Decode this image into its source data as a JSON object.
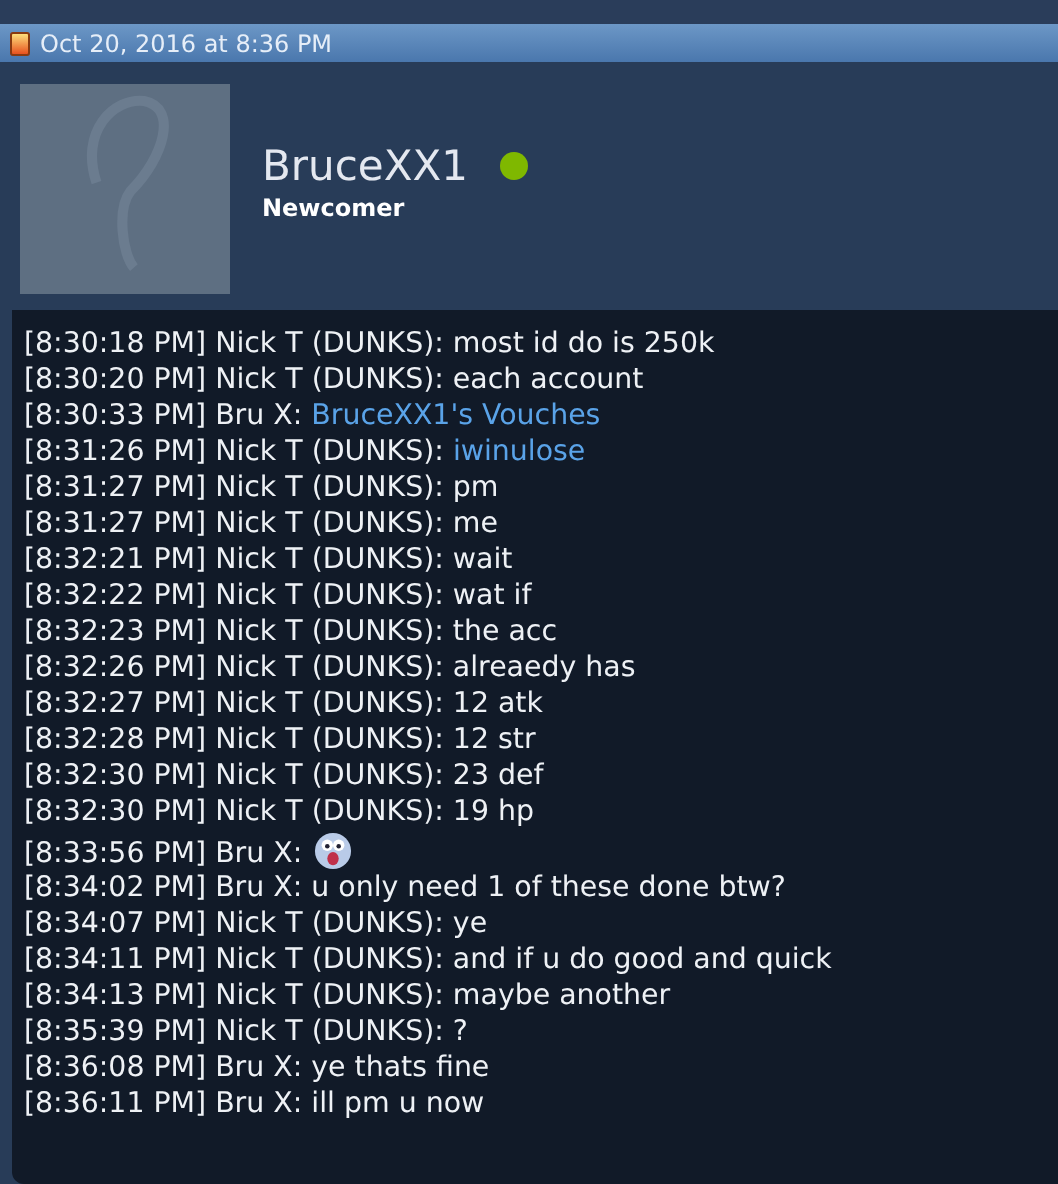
{
  "post_header": {
    "date": "Oct 20, 2016 at 8:36 PM"
  },
  "profile": {
    "username": "BruceXX1",
    "online": true,
    "rank": "Newcomer"
  },
  "chat": [
    {
      "kind": "text",
      "time": "[8:30:18 PM]",
      "author": "Nick T (DUNKS):",
      "message": "most id do is 250k"
    },
    {
      "kind": "text",
      "time": "[8:30:20 PM]",
      "author": "Nick T (DUNKS):",
      "message": "each account"
    },
    {
      "kind": "link",
      "time": "[8:30:33 PM]",
      "author": "Bru X:",
      "message": "BruceXX1's Vouches"
    },
    {
      "kind": "link",
      "time": "[8:31:26 PM]",
      "author": "Nick T (DUNKS):",
      "message": "iwinulose"
    },
    {
      "kind": "text",
      "time": "[8:31:27 PM]",
      "author": "Nick T (DUNKS):",
      "message": "pm"
    },
    {
      "kind": "text",
      "time": "[8:31:27 PM]",
      "author": "Nick T (DUNKS):",
      "message": "me"
    },
    {
      "kind": "text",
      "time": "[8:32:21 PM]",
      "author": "Nick T (DUNKS):",
      "message": "wait"
    },
    {
      "kind": "text",
      "time": "[8:32:22 PM]",
      "author": "Nick T (DUNKS):",
      "message": "wat if"
    },
    {
      "kind": "text",
      "time": "[8:32:23 PM]",
      "author": "Nick T (DUNKS):",
      "message": "the acc"
    },
    {
      "kind": "text",
      "time": "[8:32:26 PM]",
      "author": "Nick T (DUNKS):",
      "message": "alreaedy has"
    },
    {
      "kind": "text",
      "time": "[8:32:27 PM]",
      "author": "Nick T (DUNKS):",
      "message": "12 atk"
    },
    {
      "kind": "text",
      "time": "[8:32:28 PM]",
      "author": "Nick T (DUNKS):",
      "message": "12 str"
    },
    {
      "kind": "text",
      "time": "[8:32:30 PM]",
      "author": "Nick T (DUNKS):",
      "message": "23 def"
    },
    {
      "kind": "text",
      "time": "[8:32:30 PM]",
      "author": "Nick T (DUNKS):",
      "message": "19 hp"
    },
    {
      "kind": "emoji",
      "time": "[8:33:56 PM]",
      "author": "Bru X:"
    },
    {
      "kind": "text",
      "time": "[8:34:02 PM]",
      "author": "Bru X:",
      "message": "u only need 1 of these done btw?"
    },
    {
      "kind": "text",
      "time": "[8:34:07 PM]",
      "author": "Nick T (DUNKS):",
      "message": "ye"
    },
    {
      "kind": "text",
      "time": "[8:34:11 PM]",
      "author": "Nick T (DUNKS):",
      "message": "and if u do good and quick"
    },
    {
      "kind": "text",
      "time": "[8:34:13 PM]",
      "author": "Nick T (DUNKS):",
      "message": "maybe another"
    },
    {
      "kind": "text",
      "time": "[8:35:39 PM]",
      "author": "Nick T (DUNKS):",
      "message": "?"
    },
    {
      "kind": "text",
      "time": "[8:36:08 PM]",
      "author": "Bru X:",
      "message": "ye thats fine"
    },
    {
      "kind": "text",
      "time": "[8:36:11 PM]",
      "author": "Bru X:",
      "message": "ill pm u now"
    }
  ]
}
